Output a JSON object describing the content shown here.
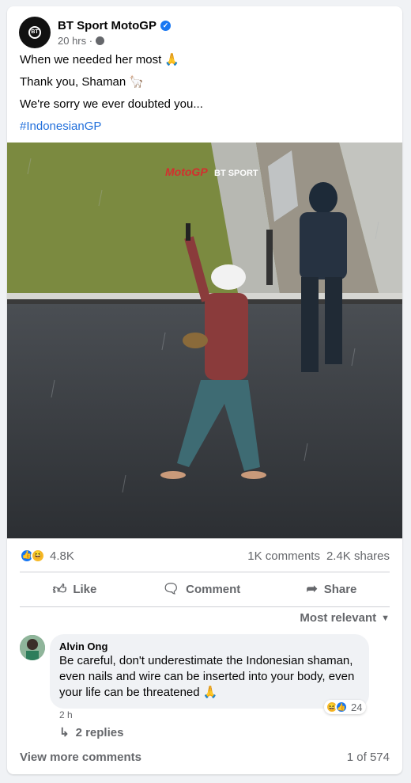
{
  "post": {
    "author": "BT Sport MotoGP",
    "avatar_text": "BT SPORT",
    "time": "20 hrs",
    "lines": [
      "When we needed her most 🙏",
      "Thank you, Shaman 🦙",
      "We're sorry we ever doubted you..."
    ],
    "hashtag": "#IndonesianGP"
  },
  "photo": {
    "watermark_left": "MotoGP",
    "watermark_right": "BT SPORT"
  },
  "stats": {
    "reactions": "4.8K",
    "comments": "1K comments",
    "shares": "2.4K shares"
  },
  "actions": {
    "like": "Like",
    "comment": "Comment",
    "share": "Share"
  },
  "sort_label": "Most relevant",
  "comment": {
    "author": "Alvin Ong",
    "text": "Be careful, don't underestimate the Indonesian shaman, even nails and wire can be inserted into your body, even your life can be threatened 🙏",
    "reaction_count": "24",
    "time": "2 h",
    "replies": "2 replies"
  },
  "footer": {
    "view_more": "View more comments",
    "pager": "1 of 574"
  },
  "colors": {
    "accent": "#1877f2",
    "hashtag": "#216fdb",
    "muted": "#65676b"
  }
}
